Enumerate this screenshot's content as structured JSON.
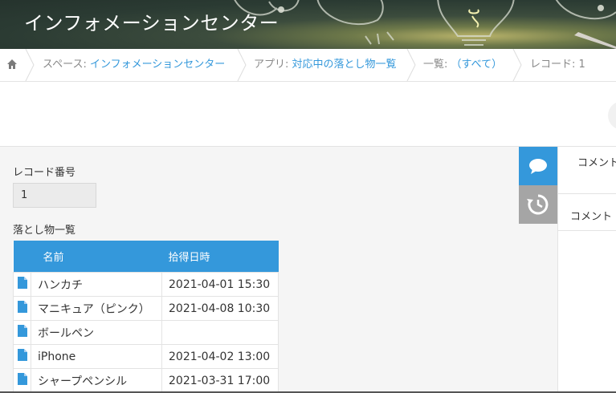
{
  "header": {
    "title": "インフォメーションセンター"
  },
  "breadcrumb": {
    "space_prefix": "スペース: ",
    "space_name": "インフォメーションセンター",
    "app_prefix": "アプリ: ",
    "app_name": "対応中の落とし物一覧",
    "list_prefix": "一覧: ",
    "list_name": "（すべて）",
    "record": "レコード: 1"
  },
  "record": {
    "number_label": "レコード番号",
    "number_value": "1",
    "table_label": "落とし物一覧",
    "columns": [
      "名前",
      "拾得日時"
    ],
    "rows": [
      {
        "name": "ハンカチ",
        "date": "2021-04-01 15:30"
      },
      {
        "name": "マニキュア（ピンク）",
        "date": "2021-04-08 10:30"
      },
      {
        "name": "ボールペン",
        "date": ""
      },
      {
        "name": "iPhone",
        "date": "2021-04-02 13:00"
      },
      {
        "name": "シャープペンシル",
        "date": "2021-03-31 17:00"
      }
    ]
  },
  "side_tabs": {
    "comment_icon": "speech-bubble-icon",
    "history_icon": "history-icon"
  },
  "panel": {
    "title": "コメント",
    "input_placeholder": "コメント"
  },
  "colors": {
    "accent": "#3498db",
    "tab_inactive": "#a5a5a5"
  }
}
